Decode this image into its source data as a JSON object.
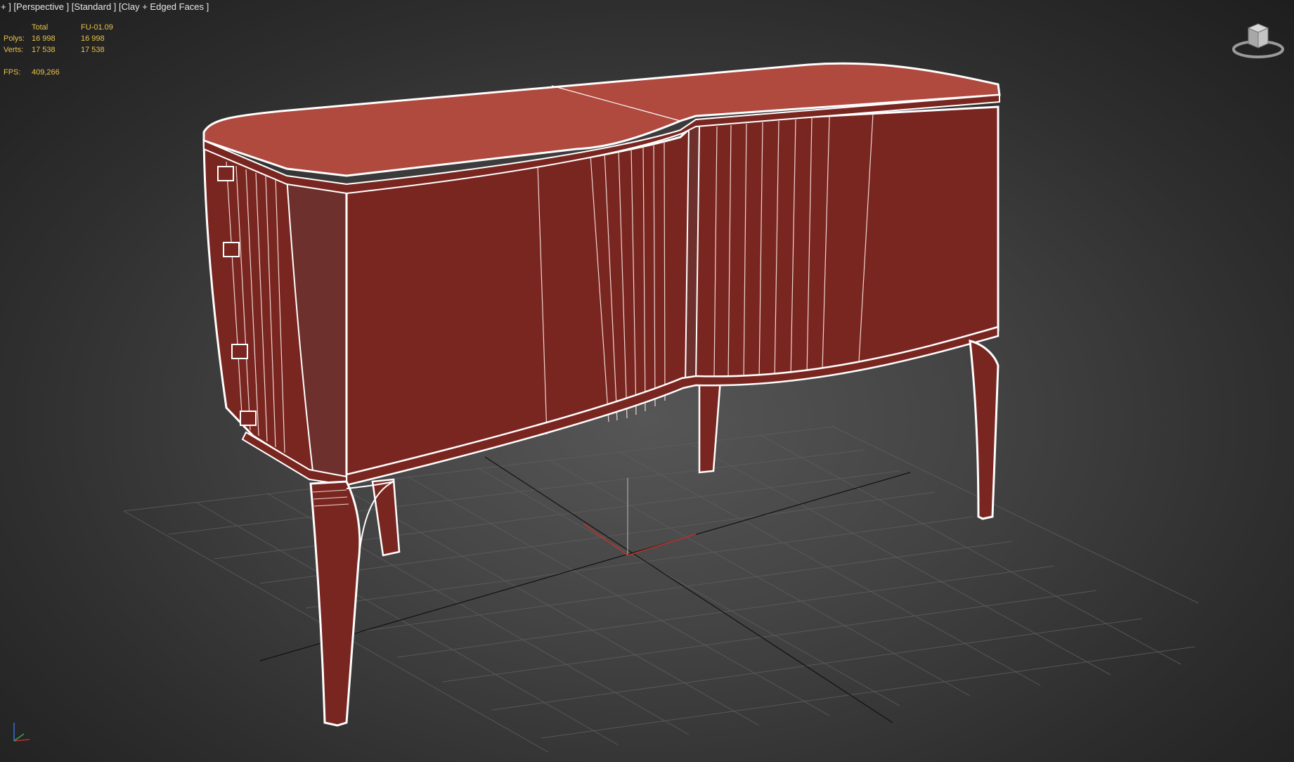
{
  "viewport": {
    "label": "+ ] [Perspective ] [Standard ] [Clay + Edged Faces ]",
    "background": "#444444"
  },
  "stats": {
    "header": {
      "label": "",
      "total": "Total",
      "object": "FU-01.09"
    },
    "polys": {
      "label": "Polys:",
      "total": "16 998",
      "object": "16 998"
    },
    "verts": {
      "label": "Verts:",
      "total": "17 538",
      "object": "17 538"
    },
    "fps": {
      "label": "FPS:",
      "value": "409,266"
    },
    "color": "#e8c24a"
  },
  "scene": {
    "object_color": "#7a2620",
    "top_color": "#b04a3f",
    "side_color": "#6e302c",
    "edge_color": "#ffffff",
    "grid_color": "#5d5d5d"
  },
  "icons": {
    "viewcube": "viewcube-icon",
    "axis": "axis-tripod-icon"
  }
}
